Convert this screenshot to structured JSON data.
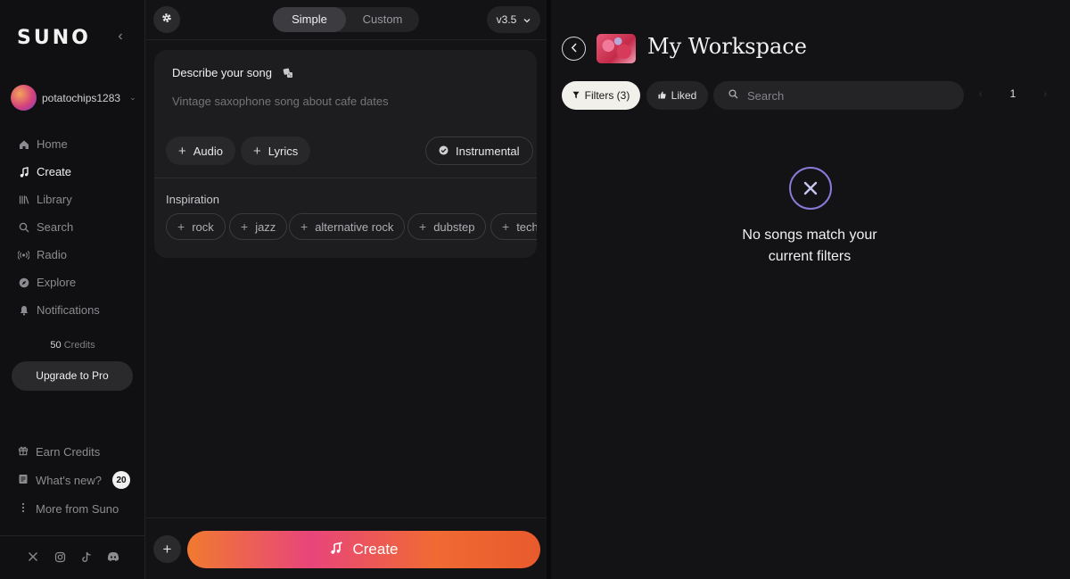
{
  "sidebar": {
    "logo": "SUNO",
    "username": "potatochips1283",
    "nav": [
      {
        "label": "Home",
        "icon": "home-icon"
      },
      {
        "label": "Create",
        "icon": "music-note-icon"
      },
      {
        "label": "Library",
        "icon": "library-icon"
      },
      {
        "label": "Search",
        "icon": "search-icon"
      },
      {
        "label": "Radio",
        "icon": "radio-icon"
      },
      {
        "label": "Explore",
        "icon": "compass-icon"
      },
      {
        "label": "Notifications",
        "icon": "bell-icon"
      }
    ],
    "active_item": "Create",
    "credits_count": "50",
    "credits_label": "Credits",
    "upgrade_label": "Upgrade to Pro",
    "bottom": {
      "earn_credits": "Earn Credits",
      "whats_new": "What's new?",
      "whats_new_count": "20",
      "more_from_suno": "More from Suno"
    },
    "socials": [
      "x-icon",
      "instagram-icon",
      "tiktok-icon",
      "discord-icon"
    ]
  },
  "create": {
    "mode_simple": "Simple",
    "mode_custom": "Custom",
    "active_mode": "Simple",
    "version": "v3.5",
    "describe_label": "Describe your song",
    "prompt_placeholder": "Vintage saxophone song about cafe dates",
    "audio_label": "Audio",
    "lyrics_label": "Lyrics",
    "instrumental_label": "Instrumental",
    "inspiration_label": "Inspiration",
    "tags": [
      "rock",
      "jazz",
      "alternative rock",
      "dubstep",
      "techno"
    ],
    "create_label": "Create"
  },
  "workspace": {
    "title": "My Workspace",
    "filters_label": "Filters (3)",
    "liked_label": "Liked",
    "search_placeholder": "Search",
    "page": "1",
    "empty_line1": "No songs match your",
    "empty_line2": "current filters"
  },
  "colors": {
    "accent_orange": "#f07a30",
    "accent_pink": "#e8457a",
    "empty_ring": "#8a7ad8"
  }
}
